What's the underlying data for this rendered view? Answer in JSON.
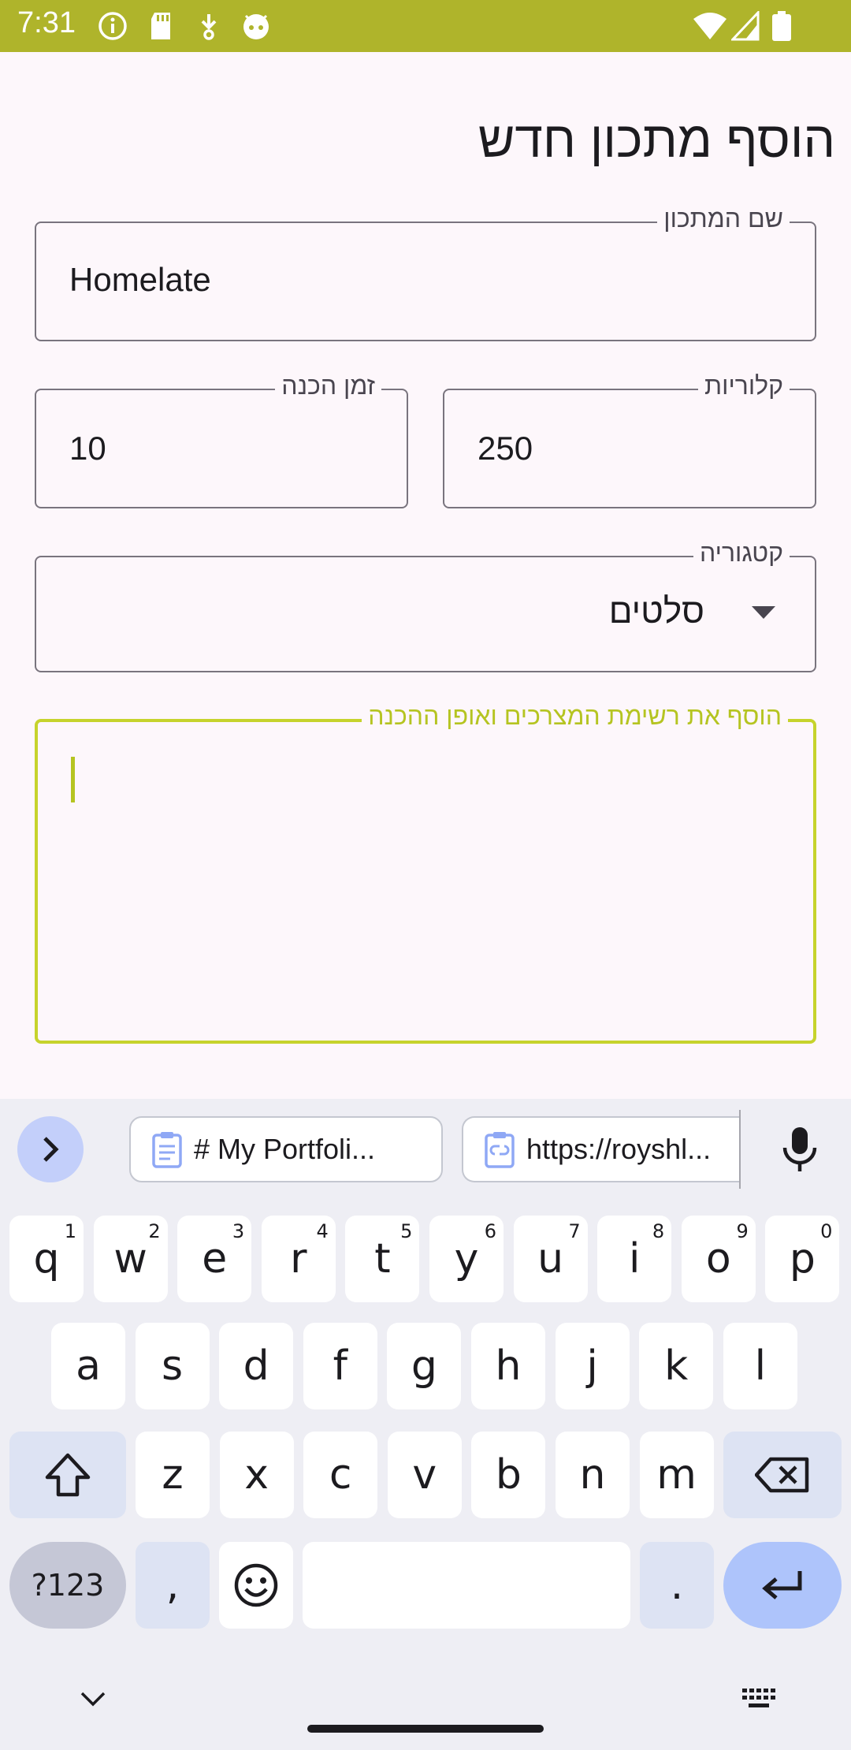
{
  "status_bar": {
    "time": "7:31"
  },
  "form": {
    "title": "הוסף מתכון חדש",
    "recipe_name": {
      "label": "שם המתכון",
      "value": "Homelate"
    },
    "prep_time": {
      "label": "זמן הכנה",
      "value": "10"
    },
    "calories": {
      "label": "קלוריות",
      "value": "250"
    },
    "category": {
      "label": "קטגוריה",
      "value": "סלטים"
    },
    "instructions": {
      "label": "הוסף את רשימת המצרכים ואופן ההכנה",
      "value": ""
    }
  },
  "keyboard": {
    "clipboard": [
      {
        "text": "# My Portfoli..."
      },
      {
        "text": "https://royshl..."
      }
    ],
    "row1": [
      {
        "k": "q",
        "h": "1"
      },
      {
        "k": "w",
        "h": "2"
      },
      {
        "k": "e",
        "h": "3"
      },
      {
        "k": "r",
        "h": "4"
      },
      {
        "k": "t",
        "h": "5"
      },
      {
        "k": "y",
        "h": "6"
      },
      {
        "k": "u",
        "h": "7"
      },
      {
        "k": "i",
        "h": "8"
      },
      {
        "k": "o",
        "h": "9"
      },
      {
        "k": "p",
        "h": "0"
      }
    ],
    "row2": [
      "a",
      "s",
      "d",
      "f",
      "g",
      "h",
      "j",
      "k",
      "l"
    ],
    "row3": [
      "z",
      "x",
      "c",
      "v",
      "b",
      "n",
      "m"
    ],
    "symbols_label": "?123",
    "comma": ",",
    "period": "."
  },
  "colors": {
    "status_bar": "#afb42b",
    "focus": "#c6d32c",
    "background": "#fdf7fb"
  }
}
